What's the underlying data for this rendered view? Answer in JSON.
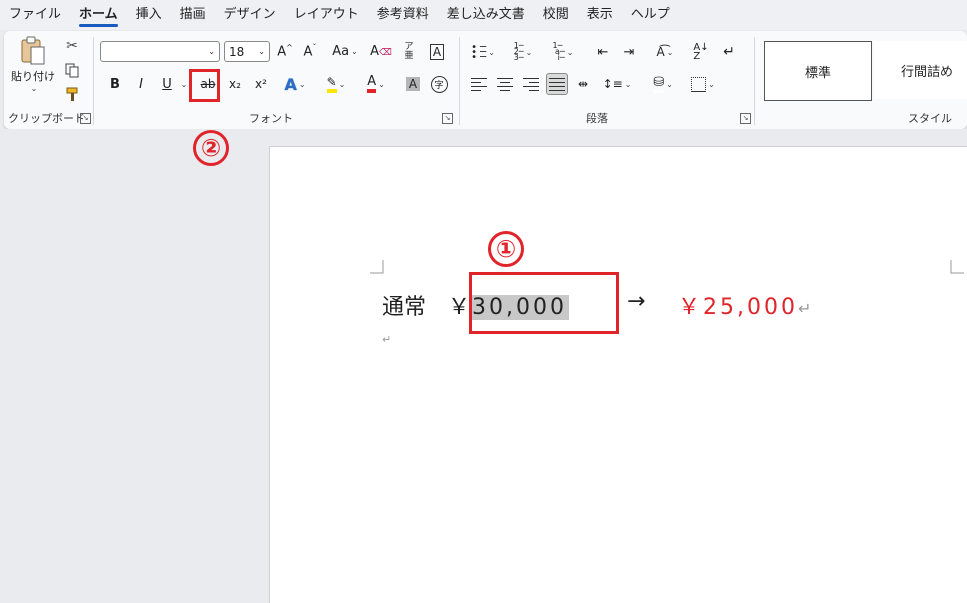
{
  "menu": {
    "tabs": [
      "ファイル",
      "ホーム",
      "挿入",
      "描画",
      "デザイン",
      "レイアウト",
      "参考資料",
      "差し込み文書",
      "校閲",
      "表示",
      "ヘルプ"
    ],
    "active": "ホーム"
  },
  "clipboard": {
    "paste_label": "貼り付け",
    "group_label": "クリップボード"
  },
  "font": {
    "name_value": "",
    "size_value": "18",
    "case_label": "Aa",
    "bold": "B",
    "italic": "I",
    "underline": "U",
    "strike": "ab",
    "sub": "x₂",
    "sup": "x²",
    "group_label": "フォント"
  },
  "paragraph": {
    "group_label": "段落"
  },
  "styles": {
    "items": [
      "標準",
      "行間詰め"
    ],
    "group_label": "スタイル"
  },
  "annotations": {
    "one": "①",
    "two": "②"
  },
  "document": {
    "line1_prefix": "通常　￥",
    "selected_price": "30,000",
    "arrow": "→",
    "new_price": "￥25,000",
    "para_mark": "↵"
  },
  "colors": {
    "accent": "#185abd",
    "annotation": "#e0242a",
    "price_red": "#e0242a",
    "selection": "#c8c8c8"
  }
}
